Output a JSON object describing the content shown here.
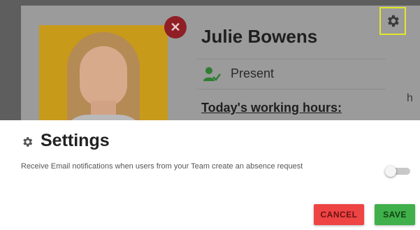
{
  "profile": {
    "name": "Julie Bowens",
    "status": "Present",
    "hours_label": "Today's working hours:",
    "hours_fragment": "h"
  },
  "settings": {
    "title": "Settings",
    "notification_text": "Receive Email notifications when users from your Team create an absence request",
    "notification_enabled": false,
    "cancel_label": "CANCEL",
    "save_label": "SAVE"
  },
  "colors": {
    "cancel": "#ef4444",
    "save": "#3fb04a",
    "highlight": "#e3e62a",
    "close": "#8f1e25"
  },
  "icons": [
    "close-icon",
    "user-present-icon",
    "gear-icon",
    "settings-gear-icon"
  ]
}
